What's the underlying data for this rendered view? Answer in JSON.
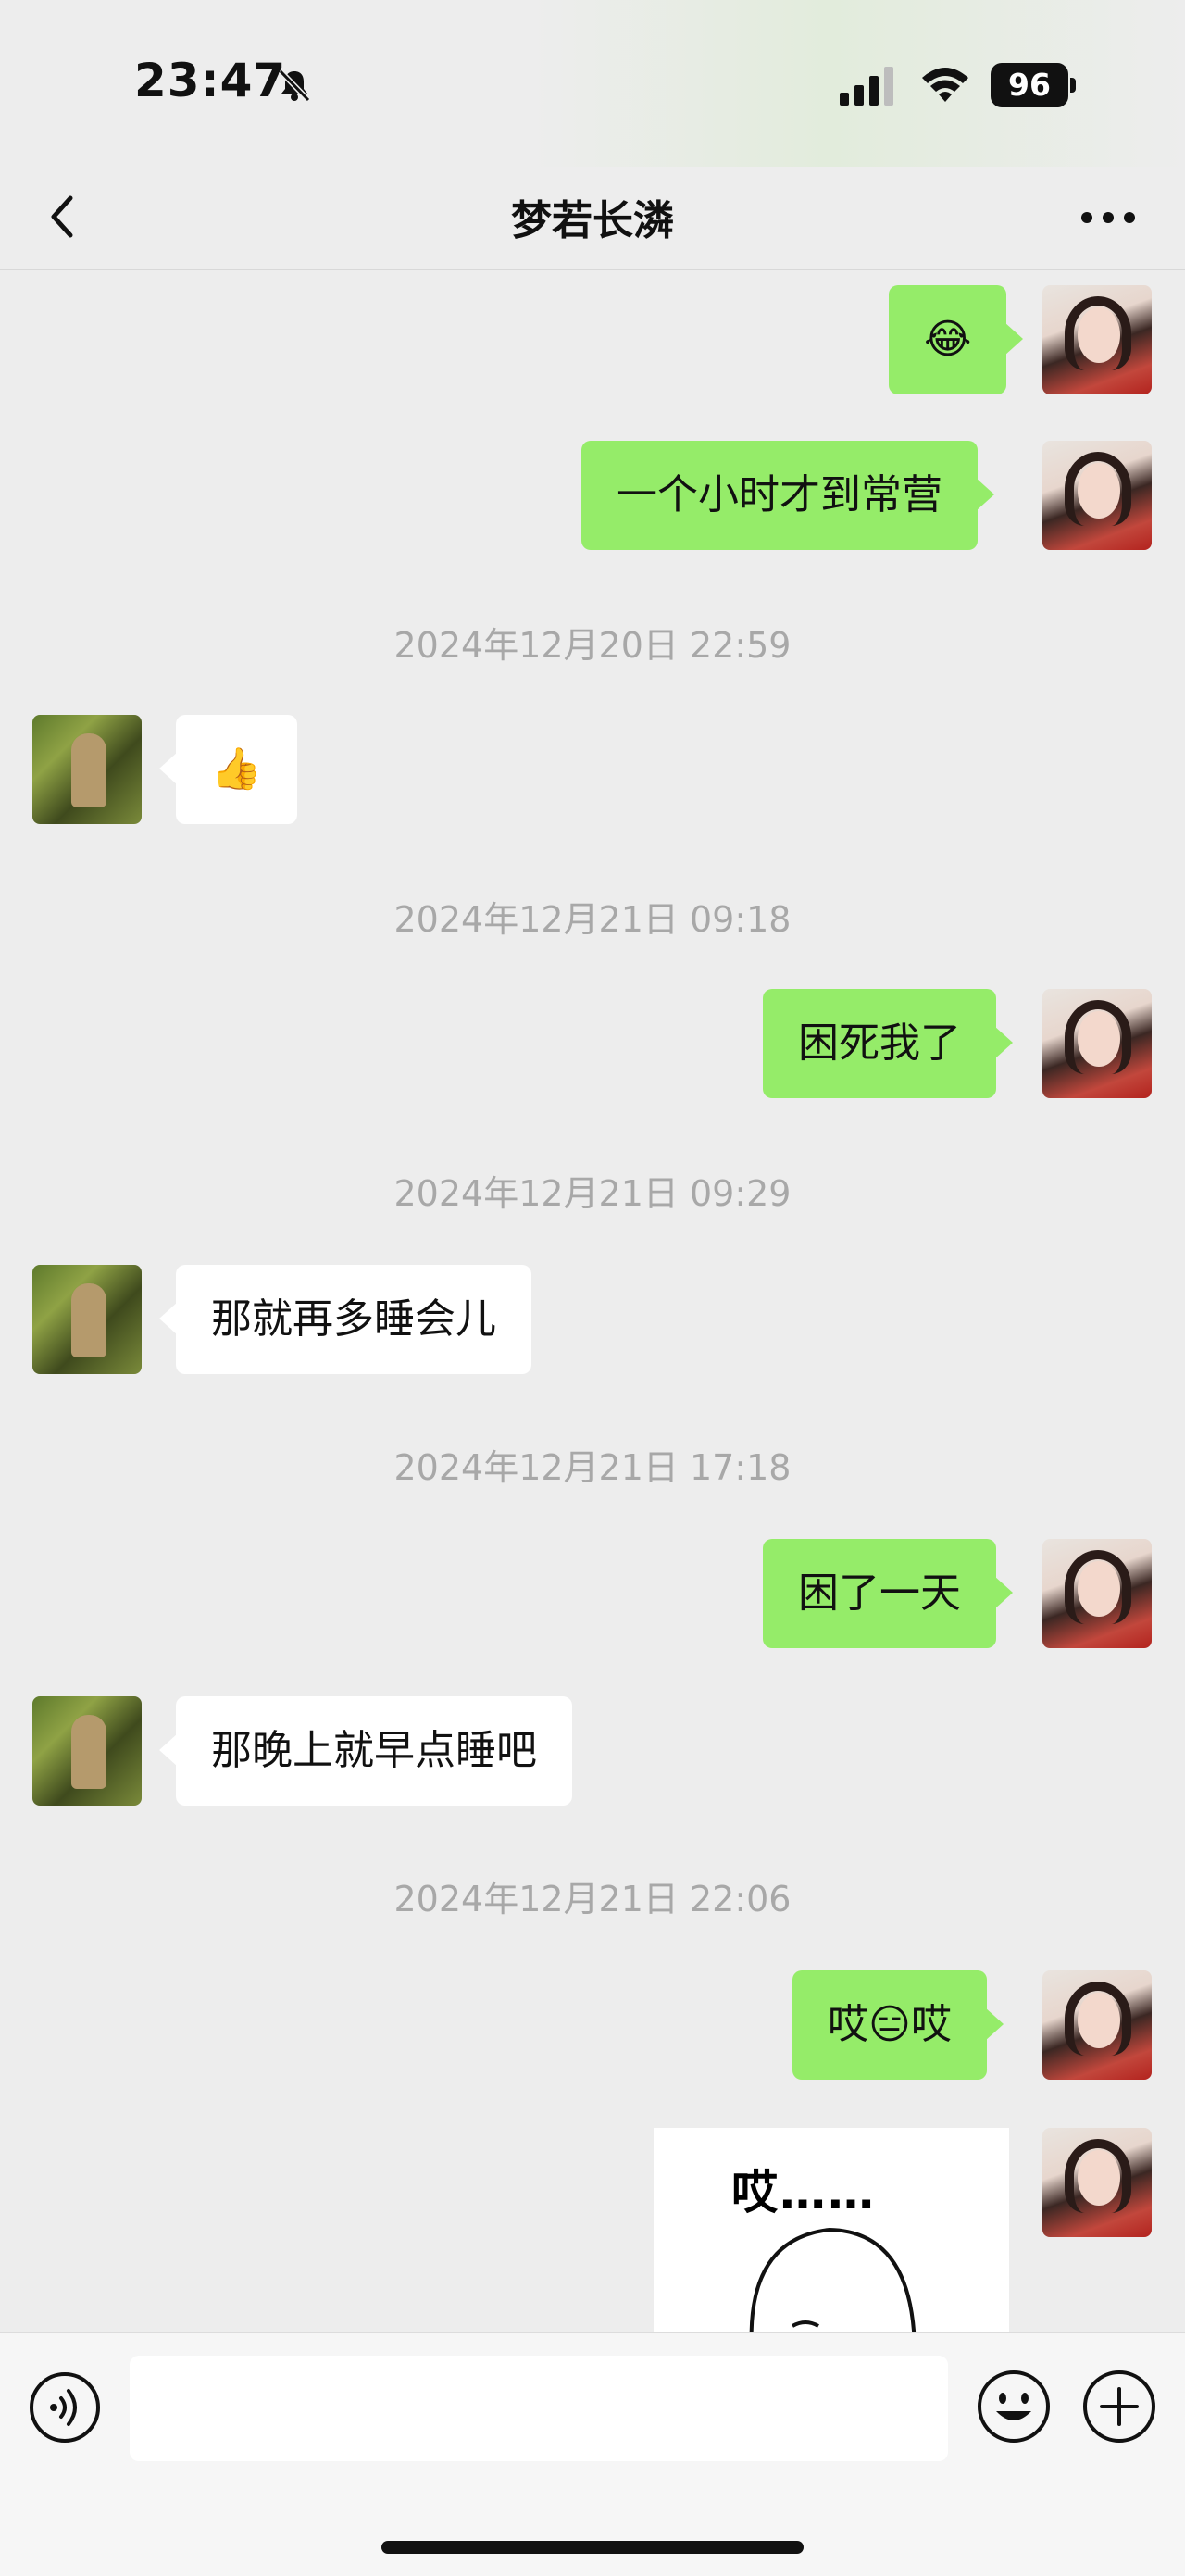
{
  "status_bar": {
    "time": "23:47",
    "battery": "96"
  },
  "nav": {
    "title": "梦若长潾"
  },
  "messages": [
    {
      "side": "me",
      "text": "😂"
    },
    {
      "side": "me",
      "text": "一个小时才到常营"
    },
    {
      "type": "timestamp",
      "text": "2024年12月20日 22:59"
    },
    {
      "side": "them",
      "text": "👍"
    },
    {
      "type": "timestamp",
      "text": "2024年12月21日 09:18"
    },
    {
      "side": "me",
      "text": "困死我了"
    },
    {
      "type": "timestamp",
      "text": "2024年12月21日 09:29"
    },
    {
      "side": "them",
      "text": "那就再多睡会儿"
    },
    {
      "type": "timestamp",
      "text": "2024年12月21日 17:18"
    },
    {
      "side": "me",
      "text": "困了一天"
    },
    {
      "side": "them",
      "text": "那晚上就早点睡吧"
    },
    {
      "type": "timestamp",
      "text": "2024年12月21日 22:06"
    },
    {
      "side": "me",
      "text": "哎😑哎"
    },
    {
      "side": "me",
      "type": "sticker",
      "text": "哎……"
    }
  ],
  "input": {
    "placeholder": ""
  },
  "icons": {
    "bell": "bell-slash-icon",
    "signal": "cellular-signal-icon",
    "wifi": "wifi-icon",
    "back": "chevron-left-icon",
    "more": "more-dots-icon",
    "voice": "voice-icon",
    "emoji": "emoji-icon",
    "plus": "plus-icon"
  },
  "colors": {
    "bubble_me": "#95ec69",
    "bubble_them": "#ffffff",
    "background": "#ededed",
    "timestamp": "#a8a8a8"
  }
}
